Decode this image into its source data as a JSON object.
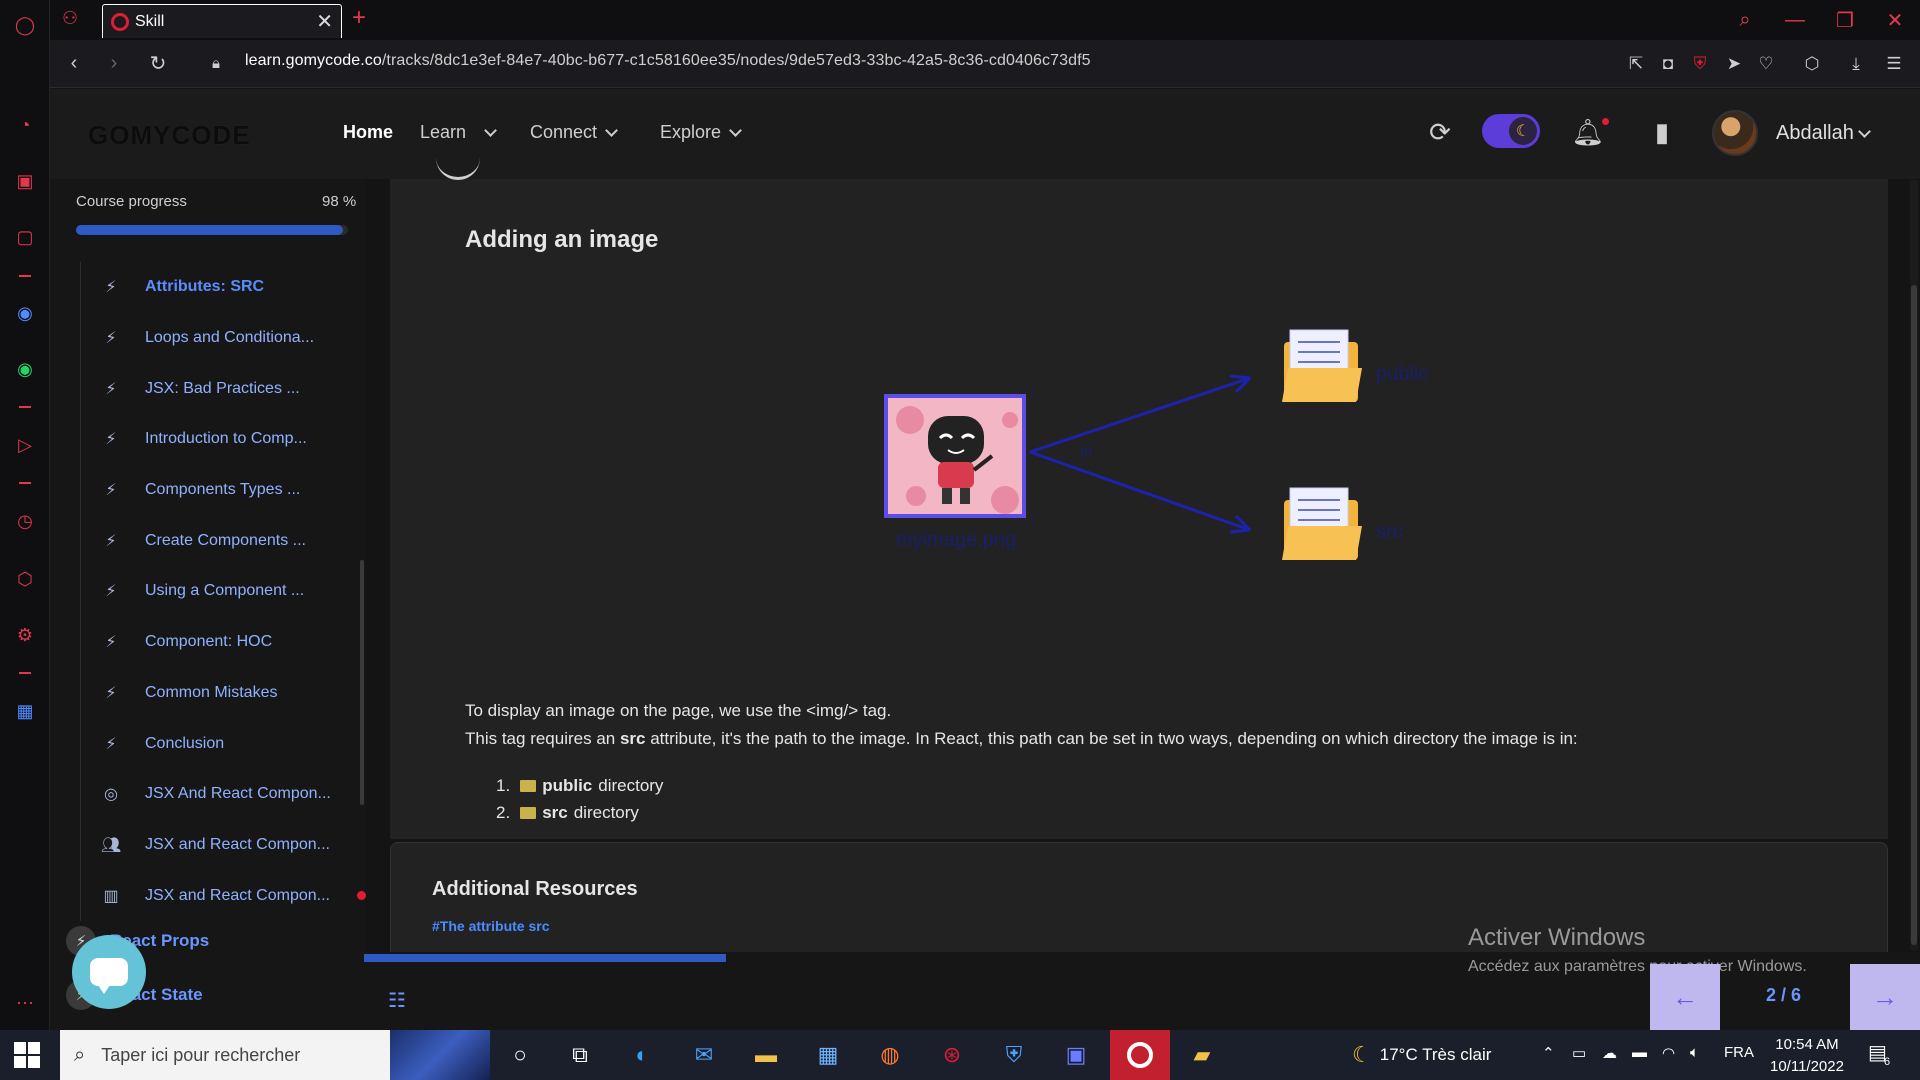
{
  "browser": {
    "tab_title": "Skill",
    "url_domain": "learn.gomycode.co",
    "url_path": "/tracks/8dc1e3ef-84e7-40bc-b677-c1c58160ee35/nodes/9de57ed3-33bc-42a5-8c36-cd0406c73df5"
  },
  "header": {
    "logo": "GOMYCODE",
    "nav": [
      {
        "label": "Home"
      },
      {
        "label": "Learn"
      },
      {
        "label": "Connect"
      },
      {
        "label": "Explore"
      }
    ],
    "username": "Abdallah",
    "dark_mode": true
  },
  "sidebar": {
    "progress_label": "Course progress",
    "progress_value": "98 %",
    "progress_fraction": 0.98,
    "lessons": [
      {
        "label": "Attributes: SRC",
        "icon": "bolt-icon",
        "current": true
      },
      {
        "label": "Loops and Conditiona...",
        "icon": "bolt-icon"
      },
      {
        "label": "JSX: Bad Practices ...",
        "icon": "bolt-icon"
      },
      {
        "label": "Introduction to Comp...",
        "icon": "bolt-icon"
      },
      {
        "label": "Components Types ...",
        "icon": "bolt-icon"
      },
      {
        "label": "Create Components ...",
        "icon": "bolt-icon"
      },
      {
        "label": "Using a Component ...",
        "icon": "bolt-icon"
      },
      {
        "label": "Component: HOC",
        "icon": "bolt-icon"
      },
      {
        "label": "Common Mistakes",
        "icon": "bolt-icon"
      },
      {
        "label": "Conclusion",
        "icon": "bolt-icon"
      },
      {
        "label": "JSX And React Compon...",
        "icon": "target-icon"
      },
      {
        "label": "JSX and React Compon...",
        "icon": "people-icon"
      },
      {
        "label": "JSX and React Compon...",
        "icon": "workshop-icon",
        "badge": true
      }
    ],
    "sections": [
      {
        "label": "React Props"
      },
      {
        "label": "React State"
      }
    ]
  },
  "content": {
    "title": "Adding an image",
    "paragraph1": "To display an image on the page, we use the <img/> tag.",
    "paragraph2_pre": "This tag requires an ",
    "paragraph2_bold": "src",
    "paragraph2_post": " attribute, it's the path to the image. In React, this path can be set in two ways, depending on which directory the image is in:",
    "list": [
      {
        "num": "1.",
        "bold": "public",
        "rest": " directory"
      },
      {
        "num": "2.",
        "bold": "src",
        "rest": " directory"
      }
    ],
    "diagram": {
      "image_label": "myimage.png",
      "arrow_label": "in",
      "folder_top": "public",
      "folder_bottom": "src"
    }
  },
  "resources": {
    "title": "Additional Resources",
    "link": "#The attribute src"
  },
  "pager": {
    "indicator": "2 / 6",
    "lesson_progress_fraction": 0.235
  },
  "watermark": {
    "title": "Activer Windows",
    "subtitle": "Accédez aux paramètres pour activer Windows."
  },
  "taskbar": {
    "search_placeholder": "Taper ici pour rechercher",
    "weather": "17°C  Très clair",
    "language": "FRA",
    "time": "10:54 AM",
    "date": "10/11/2022",
    "notification_count": "6"
  },
  "colors": {
    "accent_red": "#e11d35",
    "accent_blue": "#2f59c3",
    "link_blue": "#8fb2ff"
  }
}
